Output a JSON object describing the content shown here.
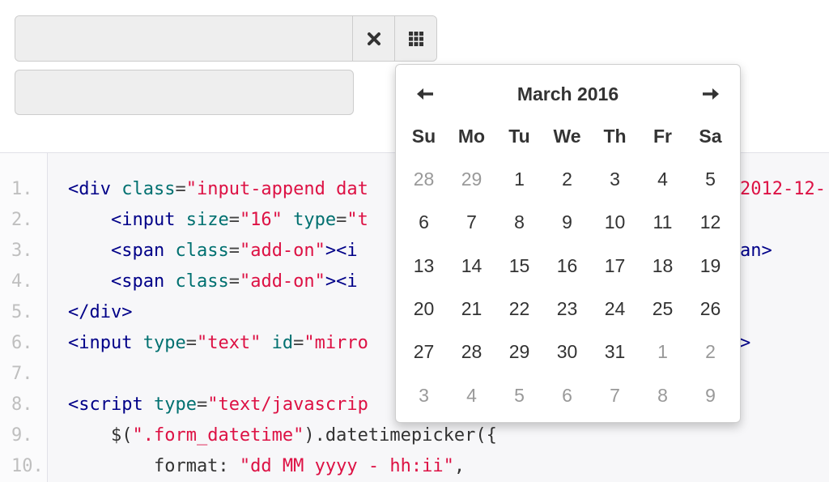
{
  "calendar": {
    "month_label": "March 2016",
    "weekdays": [
      "Su",
      "Mo",
      "Tu",
      "We",
      "Th",
      "Fr",
      "Sa"
    ],
    "weeks": [
      [
        {
          "d": "28",
          "m": true
        },
        {
          "d": "29",
          "m": true
        },
        {
          "d": "1",
          "m": false
        },
        {
          "d": "2",
          "m": false
        },
        {
          "d": "3",
          "m": false
        },
        {
          "d": "4",
          "m": false
        },
        {
          "d": "5",
          "m": false
        }
      ],
      [
        {
          "d": "6",
          "m": false
        },
        {
          "d": "7",
          "m": false
        },
        {
          "d": "8",
          "m": false
        },
        {
          "d": "9",
          "m": false
        },
        {
          "d": "10",
          "m": false
        },
        {
          "d": "11",
          "m": false
        },
        {
          "d": "12",
          "m": false
        }
      ],
      [
        {
          "d": "13",
          "m": false
        },
        {
          "d": "14",
          "m": false
        },
        {
          "d": "15",
          "m": false
        },
        {
          "d": "16",
          "m": false
        },
        {
          "d": "17",
          "m": false
        },
        {
          "d": "18",
          "m": false
        },
        {
          "d": "19",
          "m": false
        }
      ],
      [
        {
          "d": "20",
          "m": false
        },
        {
          "d": "21",
          "m": false
        },
        {
          "d": "22",
          "m": false
        },
        {
          "d": "23",
          "m": false
        },
        {
          "d": "24",
          "m": false
        },
        {
          "d": "25",
          "m": false
        },
        {
          "d": "26",
          "m": false
        }
      ],
      [
        {
          "d": "27",
          "m": false
        },
        {
          "d": "28",
          "m": false
        },
        {
          "d": "29",
          "m": false
        },
        {
          "d": "30",
          "m": false
        },
        {
          "d": "31",
          "m": false
        },
        {
          "d": "1",
          "m": true
        },
        {
          "d": "2",
          "m": true
        }
      ],
      [
        {
          "d": "3",
          "m": true
        },
        {
          "d": "4",
          "m": true
        },
        {
          "d": "5",
          "m": true
        },
        {
          "d": "6",
          "m": true
        },
        {
          "d": "7",
          "m": true
        },
        {
          "d": "8",
          "m": true
        },
        {
          "d": "9",
          "m": true
        }
      ]
    ],
    "icons": {
      "prev": "arrow-left-icon",
      "next": "arrow-right-icon"
    }
  },
  "input_addons": {
    "clear_icon": "close-icon",
    "calendar_icon": "grid-icon"
  },
  "code_lines": [
    {
      "n": "1.",
      "tokens": [
        [
          "tag",
          "<div "
        ],
        [
          "atn",
          "class"
        ],
        [
          "pun",
          "="
        ],
        [
          "atv",
          "\"input-append dat"
        ]
      ]
    },
    {
      "n": "2.",
      "tokens": [
        [
          "pln",
          "    "
        ],
        [
          "tag",
          "<input "
        ],
        [
          "atn",
          "size"
        ],
        [
          "pun",
          "="
        ],
        [
          "atv",
          "\"16\" "
        ],
        [
          "atn",
          "type"
        ],
        [
          "pun",
          "="
        ],
        [
          "atv",
          "\"t"
        ]
      ]
    },
    {
      "n": "3.",
      "tokens": [
        [
          "pln",
          "    "
        ],
        [
          "tag",
          "<span "
        ],
        [
          "atn",
          "class"
        ],
        [
          "pun",
          "="
        ],
        [
          "atv",
          "\"add-on\""
        ],
        [
          "tag",
          "><i"
        ]
      ]
    },
    {
      "n": "4.",
      "tokens": [
        [
          "pln",
          "    "
        ],
        [
          "tag",
          "<span "
        ],
        [
          "atn",
          "class"
        ],
        [
          "pun",
          "="
        ],
        [
          "atv",
          "\"add-on\""
        ],
        [
          "tag",
          "><i"
        ]
      ]
    },
    {
      "n": "5.",
      "tokens": [
        [
          "tag",
          "</div>"
        ]
      ]
    },
    {
      "n": "6.",
      "tokens": [
        [
          "tag",
          "<input "
        ],
        [
          "atn",
          "type"
        ],
        [
          "pun",
          "="
        ],
        [
          "atv",
          "\"text\" "
        ],
        [
          "atn",
          "id"
        ],
        [
          "pun",
          "="
        ],
        [
          "atv",
          "\"mirro"
        ]
      ]
    },
    {
      "n": "7.",
      "tokens": []
    },
    {
      "n": "8.",
      "tokens": [
        [
          "tag",
          "<script "
        ],
        [
          "atn",
          "type"
        ],
        [
          "pun",
          "="
        ],
        [
          "atv",
          "\"text/javascrip"
        ]
      ]
    },
    {
      "n": "9.",
      "tokens": [
        [
          "pln",
          "    $("
        ],
        [
          "atv",
          "\".form_datetime\""
        ],
        [
          "pln",
          ").datetimepicker({"
        ]
      ]
    },
    {
      "n": "10.",
      "tokens": [
        [
          "pln",
          "        format: "
        ],
        [
          "atv",
          "\"dd MM yyyy - hh:ii\""
        ],
        [
          "pln",
          ","
        ]
      ]
    }
  ],
  "code_overflow": [
    {
      "line": 1,
      "cls": "atv",
      "text": "2012-12-"
    },
    {
      "line": 3,
      "cls": "tag",
      "text": "an>"
    },
    {
      "line": 6,
      "cls": "tag",
      "text": ">"
    }
  ]
}
